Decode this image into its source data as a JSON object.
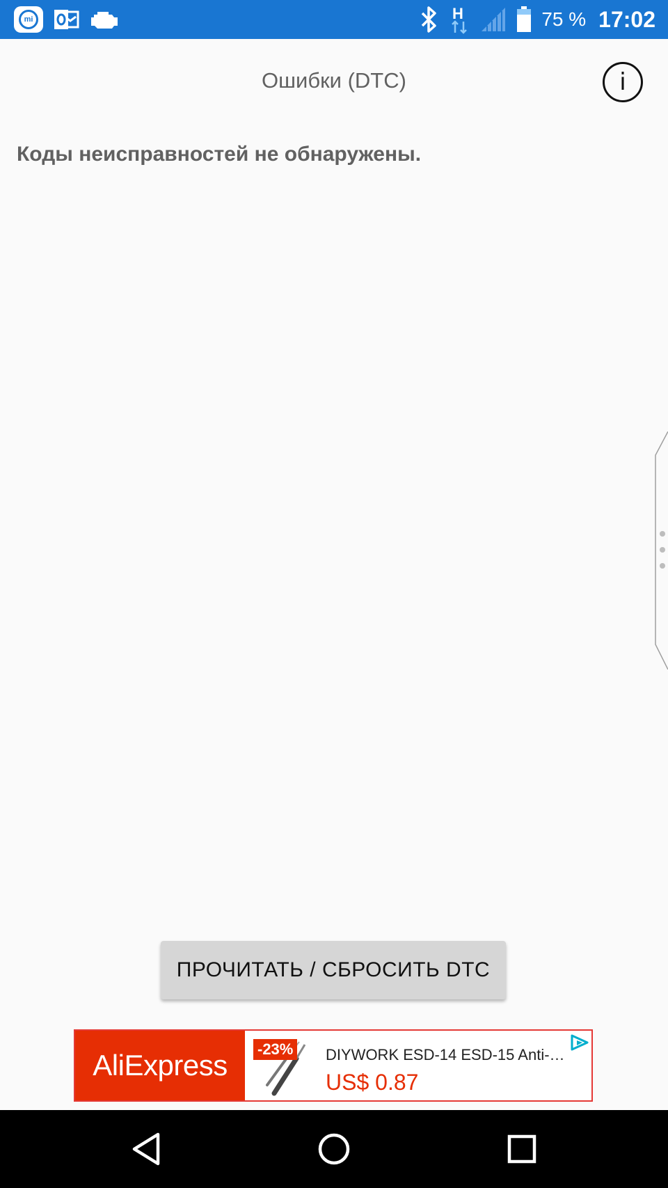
{
  "status_bar": {
    "battery_percent": "75 %",
    "time": "17:02",
    "network_type": "H",
    "icons": [
      "mi-app-icon",
      "outlook-icon",
      "engine-check-icon",
      "bluetooth-icon",
      "network-h-icon",
      "signal-icon",
      "battery-icon"
    ]
  },
  "header": {
    "title": "Ошибки (DTC)",
    "info_label": "i"
  },
  "main": {
    "status_message": "Коды неисправностей не обнаружены.",
    "action_button_label": "ПРОЧИТАТЬ / СБРОСИТЬ DTC"
  },
  "ad": {
    "brand": "AliExpress",
    "discount": "-23%",
    "product_title": "DIYWORK ESD-14 ESD-15 Anti-st...",
    "price": "US$ 0.87",
    "colors": {
      "brand_red": "#e62e04",
      "choice_blue": "#00aecd"
    }
  },
  "nav": {
    "buttons": [
      "back-icon",
      "home-icon",
      "recents-icon"
    ]
  },
  "colors": {
    "status_bar": "#1976d2",
    "background": "#fafafa",
    "button": "#d6d6d6",
    "text_muted": "#616161"
  }
}
